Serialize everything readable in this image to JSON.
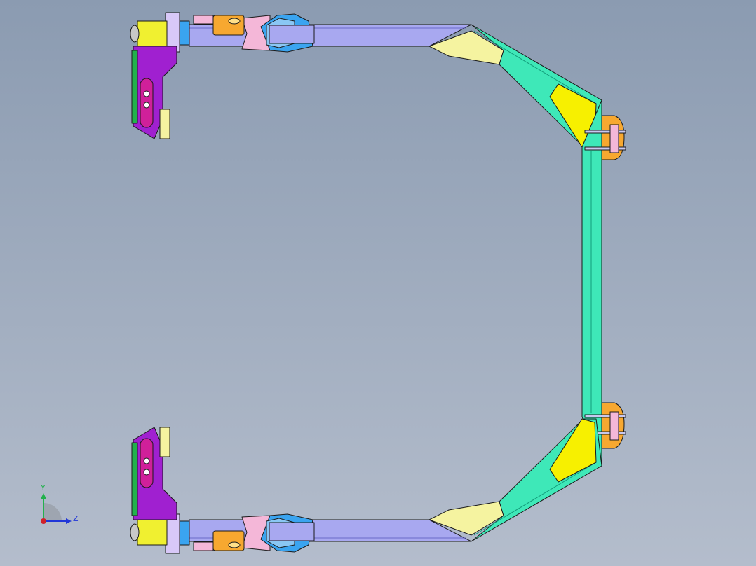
{
  "viewport": {
    "name": "cad-graphics-area"
  },
  "triad": {
    "y_label": "Y",
    "z_label": "Z",
    "y_color": "#22b14c",
    "z_color": "#2036d8",
    "x_color": "#d0202a"
  },
  "colors": {
    "frame_tube": "#a8a8f0",
    "frame_diagonal": "#3ee8b8",
    "gusset_light": "#f5f3a0",
    "gusset_yellow": "#f7f000",
    "bracket_orange": "#f7a830",
    "pin_pink": "#f4b7d8",
    "mount_purple": "#a020d0",
    "mount_magenta": "#d0209a",
    "motor_yellow": "#f0f030",
    "clamp_blue": "#3aa4f0",
    "edge": "#1a1a1a"
  }
}
